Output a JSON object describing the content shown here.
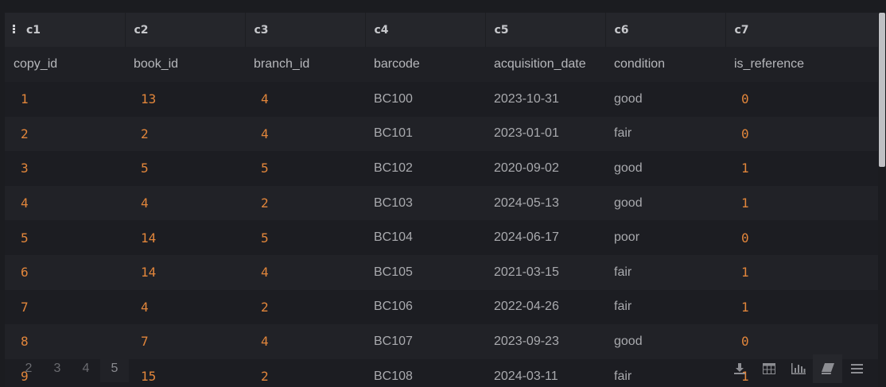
{
  "columns": [
    "c1",
    "c2",
    "c3",
    "c4",
    "c5",
    "c6",
    "c7"
  ],
  "field_names": [
    "copy_id",
    "book_id",
    "branch_id",
    "barcode",
    "acquisition_date",
    "condition",
    "is_reference"
  ],
  "rows": [
    [
      "1",
      "13",
      "4",
      "BC100",
      "2023-10-31",
      "good",
      "0"
    ],
    [
      "2",
      "2",
      "4",
      "BC101",
      "2023-01-01",
      "fair",
      "0"
    ],
    [
      "3",
      "5",
      "5",
      "BC102",
      "2020-09-02",
      "good",
      "1"
    ],
    [
      "4",
      "4",
      "2",
      "BC103",
      "2024-05-13",
      "good",
      "1"
    ],
    [
      "5",
      "14",
      "5",
      "BC104",
      "2024-06-17",
      "poor",
      "0"
    ],
    [
      "6",
      "14",
      "4",
      "BC105",
      "2021-03-15",
      "fair",
      "1"
    ],
    [
      "7",
      "4",
      "2",
      "BC106",
      "2022-04-26",
      "fair",
      "1"
    ],
    [
      "8",
      "7",
      "4",
      "BC107",
      "2023-09-23",
      "good",
      "0"
    ],
    [
      "9",
      "15",
      "2",
      "BC108",
      "2024-03-11",
      "fair",
      "1"
    ]
  ],
  "pager": {
    "pages": [
      "2",
      "3",
      "4",
      "5"
    ],
    "active": "5"
  },
  "toolbar": {
    "icons": [
      "download-icon",
      "table-icon",
      "bar-chart-icon",
      "book-icon",
      "menu-icon"
    ],
    "active": "book-icon"
  },
  "colors": {
    "background": "#1b1c20",
    "header_bg": "#25262b",
    "number": "#e2863b",
    "text": "#a9aaae"
  }
}
